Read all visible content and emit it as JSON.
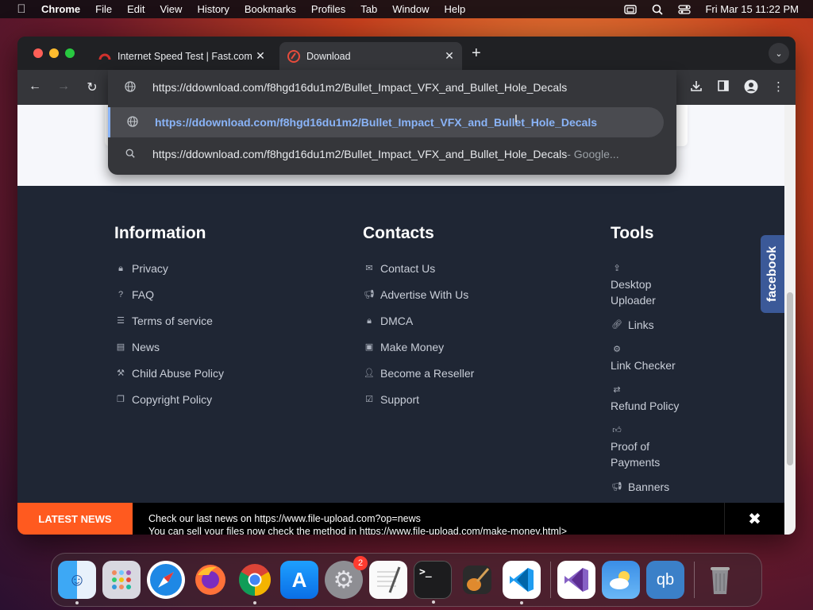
{
  "menubar": {
    "app": "Chrome",
    "items": [
      "File",
      "Edit",
      "View",
      "History",
      "Bookmarks",
      "Profiles",
      "Tab",
      "Window",
      "Help"
    ],
    "clock": "Fri Mar 15  11:22 PM"
  },
  "tabs": [
    {
      "title": "Internet Speed Test | Fast.com",
      "favicon_color": "#d0312d"
    },
    {
      "title": "Download",
      "favicon_color": "#e74c3c"
    }
  ],
  "omnibox": {
    "input_value": "https://ddownload.com/f8hgd16du1m2/Bullet_Impact_VFX_and_Bullet_Hole_Decals",
    "suggestions": [
      {
        "text": "https://ddownload.com/f8hgd16du1m2/Bullet_Impact_VFX_and_Bullet_Hole_Decals",
        "suffix": ""
      },
      {
        "text": "https://ddownload.com/f8hgd16du1m2/Bullet_Impact_VFX_and_Bullet_Hole_Decals",
        "suffix": " - Google..."
      }
    ]
  },
  "footer": {
    "information": {
      "title": "Information",
      "links": [
        "Privacy",
        "FAQ",
        "Terms of service",
        "News",
        "Child Abuse Policy",
        "Copyright Policy"
      ]
    },
    "contacts": {
      "title": "Contacts",
      "links": [
        "Contact Us",
        "Advertise With Us",
        "DMCA",
        "Make Money",
        "Become a Reseller",
        "Support"
      ]
    },
    "tools": {
      "title": "Tools",
      "links": [
        "Desktop Uploader",
        "Links",
        "Link Checker",
        "Refund Policy",
        "Proof of Payments",
        "Banners"
      ]
    }
  },
  "facebook_label": "facebook",
  "news": {
    "label": "LATEST NEWS",
    "line1": "Check our last news on https://www.file-upload.com?op=news",
    "line2": "You can sell your files now check the method in https://www.file-upload.com/make-money.html>"
  },
  "dock": {
    "apps": [
      "Finder",
      "Launchpad",
      "Safari",
      "Firefox",
      "Chrome",
      "App Store",
      "System Settings",
      "TextEdit",
      "Terminal",
      "GarageBand",
      "Visual Studio Code",
      "Visual Studio",
      "Weather",
      "qBittorrent",
      "Trash"
    ],
    "settings_badge": "2"
  },
  "colors": {
    "accent_news": "#ff5a1f",
    "footer_bg": "#1f2634",
    "omnibox_link": "#8ab4f8",
    "facebook": "#3b5998"
  }
}
